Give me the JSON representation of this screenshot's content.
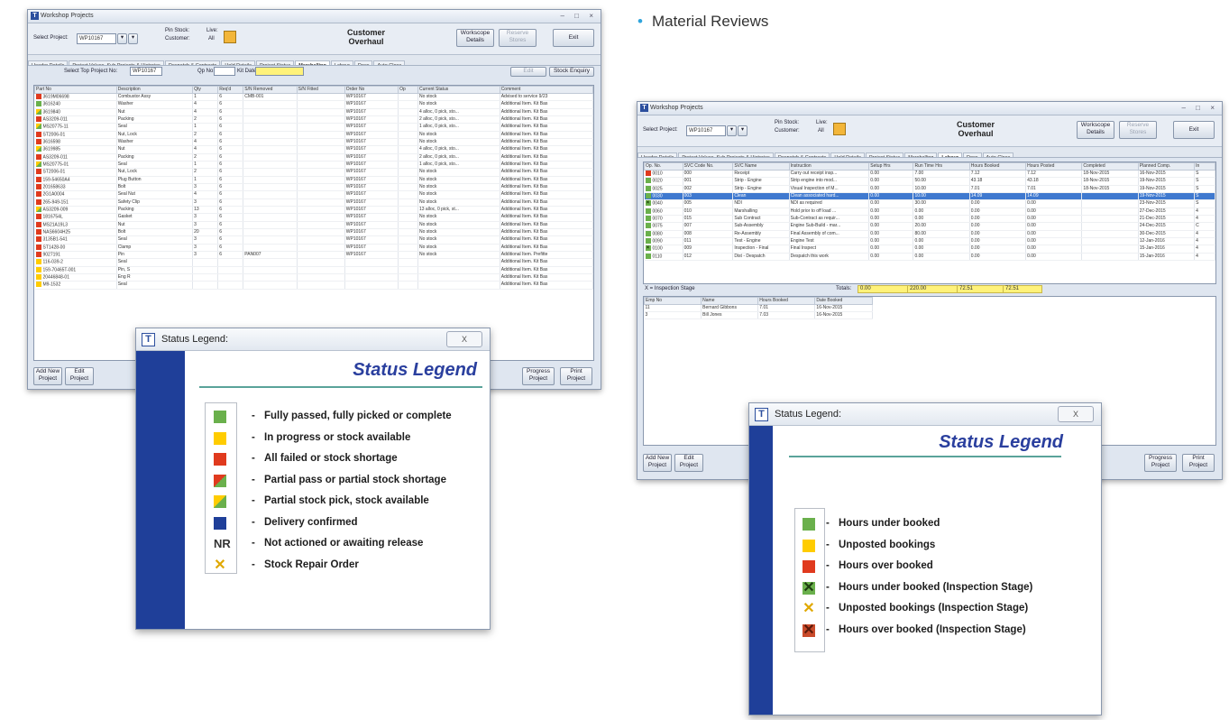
{
  "bullet": {
    "label": "Material Reviews"
  },
  "left_window": {
    "title": "Workshop Projects",
    "select_project_label": "Select Project:",
    "project_value": "WP10167",
    "pin_stock_label": "Pin Stock:",
    "customer_label": "Customer:",
    "live_label": "Live:",
    "all_value": "All",
    "center_title": [
      "Customer",
      "Overhaul"
    ],
    "workscope_button": [
      "Workscope",
      "Details"
    ],
    "reserve_button": [
      "Reserve",
      "Stores"
    ],
    "exit_button": "Exit",
    "tabs": [
      "Header Details",
      "Project Values, Sub Projects & Histories",
      "Despatch & Contracts",
      "Hold Details",
      "Project Status",
      "Marshalling",
      "Labour",
      "Docs",
      "Auto Close"
    ],
    "active_tab": "Marshalling",
    "sub_labels": {
      "top_project": "Select Top Project No:",
      "top_value": "WP10167",
      "qp": "Qp No:",
      "kit": "Kit Date:",
      "edit": "Edit",
      "stock": "Stock Enquiry"
    },
    "columns": [
      "Part No",
      "Description",
      "Qty",
      "Req'd",
      "S/N Removed",
      "S/N Fitted",
      "Order No",
      "Op",
      "Current Status",
      "Comment"
    ],
    "rows": [
      {
        "status": "red",
        "part": "3619M06698",
        "desc": "Combustor Assy",
        "qty": "1",
        "req": "6",
        "snr": "CMB-001",
        "order": "WP10167",
        "cur": "No stock",
        "comment": "Advised to service 9/23"
      },
      {
        "status": "green",
        "part": "3616240",
        "desc": "Washer",
        "qty": "4",
        "req": "6",
        "snr": "",
        "order": "WP10167",
        "cur": "No stock",
        "comment": "Additional Item. Kit Bas"
      },
      {
        "status": "yg",
        "part": "3619840",
        "desc": "Nut",
        "qty": "4",
        "req": "6",
        "snr": "",
        "order": "WP10167",
        "cur": "4 alloc, 0 pick, sto...",
        "comment": "Additional Item. Kit Bas"
      },
      {
        "status": "red",
        "part": "AS3209-011",
        "desc": "Packing",
        "qty": "2",
        "req": "6",
        "snr": "",
        "order": "WP10167",
        "cur": "2 alloc, 0 pick, sto...",
        "comment": "Additional Item. Kit Bas"
      },
      {
        "status": "yg",
        "part": "MS20775-11",
        "desc": "Seal",
        "qty": "1",
        "req": "6",
        "snr": "",
        "order": "WP10167",
        "cur": "1 alloc, 0 pick, sto...",
        "comment": "Additional Item. Kit Bas"
      },
      {
        "status": "red",
        "part": "ST2006-01",
        "desc": "Nut, Lock",
        "qty": "2",
        "req": "6",
        "snr": "",
        "order": "WP10167",
        "cur": "No stock",
        "comment": "Additional Item. Kit Bas"
      },
      {
        "status": "red",
        "part": "3616598",
        "desc": "Washer",
        "qty": "4",
        "req": "6",
        "snr": "",
        "order": "WP10167",
        "cur": "No stock",
        "comment": "Additional Item. Kit Bas"
      },
      {
        "status": "yg",
        "part": "3619985",
        "desc": "Nut",
        "qty": "4",
        "req": "6",
        "snr": "",
        "order": "WP10167",
        "cur": "4 alloc, 0 pick, sto...",
        "comment": "Additional Item. Kit Bas"
      },
      {
        "status": "red",
        "part": "AS3209-011",
        "desc": "Packing",
        "qty": "2",
        "req": "6",
        "snr": "",
        "order": "WP10167",
        "cur": "2 alloc, 0 pick, sto...",
        "comment": "Additional Item. Kit Bas"
      },
      {
        "status": "yg",
        "part": "MS20775-01",
        "desc": "Seal",
        "qty": "1",
        "req": "6",
        "snr": "",
        "order": "WP10167",
        "cur": "1 alloc, 0 pick, sto...",
        "comment": "Additional Item. Kit Bas"
      },
      {
        "status": "red",
        "part": "ST2006-01",
        "desc": "Nut, Lock",
        "qty": "2",
        "req": "6",
        "snr": "",
        "order": "WP10167",
        "cur": "No stock",
        "comment": "Additional Item. Kit Bas"
      },
      {
        "status": "red",
        "part": "159-54650A4",
        "desc": "Plug Button",
        "qty": "1",
        "req": "6",
        "snr": "",
        "order": "WP10167",
        "cur": "No stock",
        "comment": "Additional Item. Kit Bas"
      },
      {
        "status": "red",
        "part": "201658633",
        "desc": "Bolt",
        "qty": "3",
        "req": "6",
        "snr": "",
        "order": "WP10167",
        "cur": "No stock",
        "comment": "Additional Item. Kit Bas"
      },
      {
        "status": "red",
        "part": "2G1A0004",
        "desc": "Seal Nut",
        "qty": "4",
        "req": "6",
        "snr": "",
        "order": "WP10167",
        "cur": "No stock",
        "comment": "Additional Item. Kit Bas"
      },
      {
        "status": "red",
        "part": "265-949-151",
        "desc": "Safety Clip",
        "qty": "3",
        "req": "6",
        "snr": "",
        "order": "WP10167",
        "cur": "No stock",
        "comment": "Additional Item. Kit Bas"
      },
      {
        "status": "yg",
        "part": "AS3209-009",
        "desc": "Packing",
        "qty": "13",
        "req": "6",
        "snr": "",
        "order": "WP10167",
        "cur": "13 alloc, 0 pick, st...",
        "comment": "Additional Item. Kit Bas"
      },
      {
        "status": "red",
        "part": "1816754L",
        "desc": "Gasket",
        "qty": "3",
        "req": "6",
        "snr": "",
        "order": "WP10167",
        "cur": "No stock",
        "comment": "Additional Item. Kit Bas"
      },
      {
        "status": "red",
        "part": "MS21A19L3",
        "desc": "Nut",
        "qty": "3",
        "req": "6",
        "snr": "",
        "order": "WP10167",
        "cur": "No stock",
        "comment": "Additional Item. Kit Bas"
      },
      {
        "status": "red",
        "part": "NAS6604H25",
        "desc": "Bolt",
        "qty": "20",
        "req": "6",
        "snr": "",
        "order": "WP10167",
        "cur": "No stock",
        "comment": "Additional Item. Kit Bas"
      },
      {
        "status": "red",
        "part": "3135B1-541",
        "desc": "Seal",
        "qty": "3",
        "req": "6",
        "snr": "",
        "order": "WP10167",
        "cur": "No stock",
        "comment": "Additional Item. Kit Bas"
      },
      {
        "status": "red",
        "part": "ST1428-00",
        "desc": "Clamp",
        "qty": "3",
        "req": "6",
        "snr": "",
        "order": "WP10167",
        "cur": "No stock",
        "comment": "Additional Item. Kit Bas"
      },
      {
        "status": "red",
        "part": "9027191",
        "desc": "Pin",
        "qty": "3",
        "req": "6",
        "snr": "PAN007",
        "order": "WP10167",
        "cur": "No stock",
        "comment": "Additional Item. Prefitte"
      },
      {
        "status": "yellow",
        "part": "116-039-2",
        "desc": "Seal",
        "qty": "",
        "req": "",
        "snr": "",
        "order": "",
        "cur": "",
        "comment": "Additional Item. Kit Bas"
      },
      {
        "status": "yellow",
        "part": "159-70465T-001",
        "desc": "Pin, S",
        "qty": "",
        "req": "",
        "snr": "",
        "order": "",
        "cur": "",
        "comment": "Additional Item. Kit Bas"
      },
      {
        "status": "yellow",
        "part": "20446848-01",
        "desc": "Eng R",
        "qty": "",
        "req": "",
        "snr": "",
        "order": "",
        "cur": "",
        "comment": "Additional Item. Kit Bas"
      },
      {
        "status": "yellow",
        "part": "M9-1532",
        "desc": "Seal",
        "qty": "",
        "req": "",
        "snr": "",
        "order": "",
        "cur": "",
        "comment": "Additional Item. Kit Bas"
      }
    ],
    "bottom_buttons": {
      "add": [
        "Add New",
        "Project"
      ],
      "edit": [
        "Edit",
        "Project"
      ],
      "progress": [
        "Progress",
        "Project"
      ],
      "print": [
        "Print",
        "Project"
      ]
    }
  },
  "left_legend": {
    "title": "Status Legend:",
    "close": "X",
    "heading": "Status Legend",
    "items": [
      {
        "swatch": "green",
        "text": "Fully passed, fully picked or complete"
      },
      {
        "swatch": "yellow",
        "text": "In progress or stock available"
      },
      {
        "swatch": "red",
        "text": "All failed or stock shortage"
      },
      {
        "swatch": "red-green",
        "text": "Partial pass or partial stock shortage"
      },
      {
        "swatch": "yellow-green",
        "text": "Partial stock pick, stock available"
      },
      {
        "swatch": "blue",
        "text": "Delivery confirmed"
      },
      {
        "swatch": "NR",
        "text": "Not actioned or awaiting release"
      },
      {
        "swatch": "x-yellow",
        "text": "Stock Repair Order"
      }
    ]
  },
  "right_window": {
    "title": "Workshop Projects",
    "select_project_label": "Select Project:",
    "project_value": "WP10167",
    "pin_stock_label": "Pin Stock:",
    "customer_label": "Customer:",
    "live_label": "Live:",
    "all_value": "All",
    "center_title": [
      "Customer",
      "Overhaul"
    ],
    "workscope_button": [
      "Workscope",
      "Details"
    ],
    "reserve_button": [
      "Reserve",
      "Stores"
    ],
    "exit_button": "Exit",
    "tabs": [
      "Header Details",
      "Project Values, Sub Projects & Histories",
      "Despatch & Contracts",
      "Hold Details",
      "Project Status",
      "Marshalling",
      "Labour",
      "Docs",
      "Auto Close"
    ],
    "active_tab": "Labour",
    "columns": [
      "Op. No.",
      "SVC Code No.",
      "SVC Name",
      "Instruction",
      "Setup Hrs",
      "Run Time Hrs",
      "Hours Booked",
      "Hours Posted",
      "Completed",
      "Planned Comp.",
      "In"
    ],
    "rows": [
      {
        "status": "red",
        "op": "0010",
        "code": "000",
        "name": "Receipt",
        "instr": "Carry out receipt insp...",
        "setup": "0.00",
        "run": "7.00",
        "booked": "7.12",
        "posted": "7.12",
        "completed": "18-Nov-2015",
        "planned": "16-Nov-2015",
        "inn": "S"
      },
      {
        "status": "green",
        "op": "0020",
        "code": "001",
        "name": "Strip - Engine",
        "instr": "Strip engine into mod...",
        "setup": "0.00",
        "run": "50.00",
        "booked": "43.18",
        "posted": "43.18",
        "completed": "18-Nov-2015",
        "planned": "19-Nov-2015",
        "inn": "S"
      },
      {
        "status": "green",
        "op": "0025",
        "code": "002",
        "name": "Strip - Engine",
        "instr": "Visual Inspection of M...",
        "setup": "0.00",
        "run": "10.00",
        "booked": "7.01",
        "posted": "7.01",
        "completed": "18-Nov-2015",
        "planned": "19-Nov-2015",
        "inn": "S"
      },
      {
        "status": "green",
        "op": "0030",
        "code": "003",
        "name": "Clean",
        "instr": "Clean associated hard...",
        "setup": "0.00",
        "run": "10.00",
        "booked": "14.09",
        "posted": "14.09",
        "completed": "",
        "planned": "19-Nov-2015",
        "inn": "S",
        "selected": true
      },
      {
        "status": "xg",
        "op": "0040",
        "code": "005",
        "name": "NDI",
        "instr": "NDI as required",
        "setup": "0.00",
        "run": "30.00",
        "booked": "0.00",
        "posted": "0.00",
        "completed": "",
        "planned": "23-Nov-2015",
        "inn": "S"
      },
      {
        "status": "green",
        "op": "0060",
        "code": "010",
        "name": "Marshalling",
        "instr": "Hold prior to off load ...",
        "setup": "0.00",
        "run": "0.00",
        "booked": "0.00",
        "posted": "0.00",
        "completed": "",
        "planned": "27-Dec-2015",
        "inn": "4"
      },
      {
        "status": "green",
        "op": "0070",
        "code": "015",
        "name": "Sub Contract",
        "instr": "Sub-Contract as requir...",
        "setup": "0.00",
        "run": "0.00",
        "booked": "0.00",
        "posted": "0.00",
        "completed": "",
        "planned": "21-Dec-2015",
        "inn": "4"
      },
      {
        "status": "green",
        "op": "0075",
        "code": "007",
        "name": "Sub-Assembly",
        "instr": "Engine Sub-Build - mar...",
        "setup": "0.00",
        "run": "20.00",
        "booked": "0.00",
        "posted": "0.00",
        "completed": "",
        "planned": "24-Dec-2015",
        "inn": "C"
      },
      {
        "status": "green",
        "op": "0080",
        "code": "008",
        "name": "Re-Assembly",
        "instr": "Final Assembly of com...",
        "setup": "0.00",
        "run": "80.00",
        "booked": "0.00",
        "posted": "0.00",
        "completed": "",
        "planned": "30-Dec-2015",
        "inn": "4"
      },
      {
        "status": "green",
        "op": "0090",
        "code": "011",
        "name": "Test - Engine",
        "instr": "Engine Test",
        "setup": "0.00",
        "run": "0.00",
        "booked": "0.00",
        "posted": "0.00",
        "completed": "",
        "planned": "12-Jan-2016",
        "inn": "4"
      },
      {
        "status": "xg",
        "op": "0100",
        "code": "009",
        "name": "Inspection - Final",
        "instr": "Final Inspect",
        "setup": "0.00",
        "run": "0.00",
        "booked": "0.00",
        "posted": "0.00",
        "completed": "",
        "planned": "15-Jan-2016",
        "inn": "4"
      },
      {
        "status": "green",
        "op": "0110",
        "code": "012",
        "name": "Dist - Despatch",
        "instr": "Despatch this work",
        "setup": "0.00",
        "run": "0.00",
        "booked": "0.00",
        "posted": "0.00",
        "completed": "",
        "planned": "15-Jan-2016",
        "inn": "4"
      }
    ],
    "inspection_label": "X = Inspection Stage",
    "totals_label": "Totals:",
    "totals": [
      "0.00",
      "220.00",
      "72.51",
      "72.51"
    ],
    "emp_columns": [
      "Emp No",
      "Name",
      "Hours Booked",
      "Date Booked"
    ],
    "emp_rows": [
      {
        "no": "11",
        "name": "Bernard Gibbons",
        "hours": "7.01",
        "date": "16-Nov-2015"
      },
      {
        "no": "3",
        "name": "Bill Jones",
        "hours": "7.03",
        "date": "16-Nov-2015"
      }
    ],
    "bottom_buttons": {
      "add": [
        "Add New",
        "Project"
      ],
      "edit": [
        "Edit",
        "Project"
      ],
      "progress": [
        "Progress",
        "Project"
      ],
      "print": [
        "Print",
        "Project"
      ]
    }
  },
  "right_legend": {
    "title": "Status Legend:",
    "close": "X",
    "heading": "Status Legend",
    "items": [
      {
        "swatch": "green",
        "text": "Hours under booked"
      },
      {
        "swatch": "yellow",
        "text": "Unposted bookings"
      },
      {
        "swatch": "red",
        "text": "Hours over booked"
      },
      {
        "swatch": "x-green",
        "text": "Hours under booked (Inspection Stage)"
      },
      {
        "swatch": "x-yellow",
        "text": "Unposted bookings (Inspection Stage)"
      },
      {
        "swatch": "x-red",
        "text": "Hours over booked (Inspection Stage)"
      }
    ]
  }
}
